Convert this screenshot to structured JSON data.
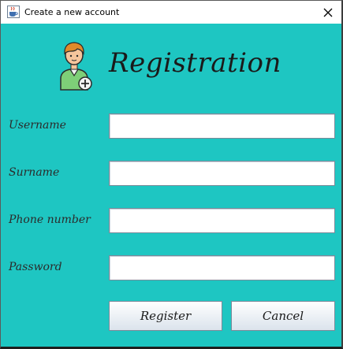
{
  "window": {
    "title": "Create a new account",
    "close_label": "×"
  },
  "form": {
    "heading": "Registration",
    "fields": [
      {
        "label": "Username",
        "value": ""
      },
      {
        "label": "Surname",
        "value": ""
      },
      {
        "label": "Phone number",
        "value": ""
      },
      {
        "label": "Password",
        "value": ""
      }
    ],
    "register_label": "Register",
    "cancel_label": "Cancel"
  },
  "icons": {
    "app": "java-cup-icon",
    "hero": "user-add-icon",
    "close": "close-icon"
  },
  "colors": {
    "background": "#1ec6c2",
    "avatar_shirt": "#7ecf78",
    "avatar_hair": "#e08a2a"
  }
}
